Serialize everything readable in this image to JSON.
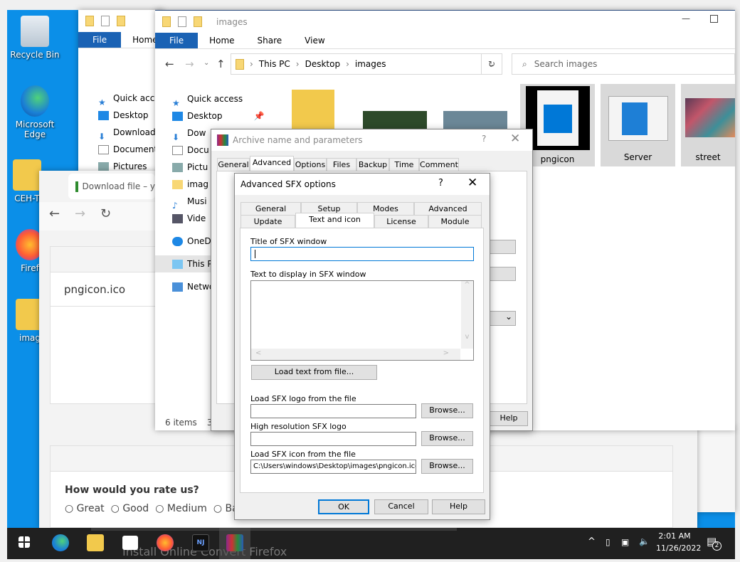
{
  "desktop": {
    "icons": [
      {
        "label": "Recycle Bin"
      },
      {
        "label": "Microsoft Edge"
      },
      {
        "label": "CEH-T"
      },
      {
        "label": "Firef"
      },
      {
        "label": "imag"
      }
    ]
  },
  "explorer_back": {
    "tabs": [
      "File",
      "Home"
    ],
    "nav": [
      "Quick acces",
      "Desktop",
      "Download",
      "Document",
      "Pictures"
    ]
  },
  "explorer": {
    "title": "images",
    "tabs": [
      "File",
      "Home",
      "Share",
      "View"
    ],
    "breadcrumb": [
      "This PC",
      "Desktop",
      "images"
    ],
    "search_placeholder": "Search images",
    "nav": [
      "Quick access",
      "Desktop",
      "Dow",
      "Docu",
      "Pictu",
      "imag",
      "Musi",
      "Vide",
      "OneDr",
      "This P",
      "Netwo"
    ],
    "items": [
      {
        "name": ""
      },
      {
        "name": ""
      },
      {
        "name": ""
      },
      {
        "name": "pngicon"
      },
      {
        "name": "Server"
      },
      {
        "name": "street"
      }
    ],
    "status": "6 items",
    "status2": "3"
  },
  "browser": {
    "tab_title": "Download file – y",
    "file_name": "pngicon.ico",
    "rate_question": "How would you rate us?",
    "rate_options": [
      "Great",
      "Good",
      "Medium",
      "Ba"
    ],
    "bottom_text": "Install Online Convert Firefox"
  },
  "archive_dialog": {
    "title": "Archive name and parameters",
    "help": "?",
    "tabs": [
      "General",
      "Advanced",
      "Options",
      "Files",
      "Backup",
      "Time",
      "Comment"
    ],
    "active_tab": "Advanced",
    "help_button": "Help"
  },
  "sfx_dialog": {
    "title": "Advanced SFX options",
    "help": "?",
    "tabs_row1": [
      "General",
      "Setup",
      "Modes",
      "Advanced"
    ],
    "tabs_row2": [
      "Update",
      "Text and icon",
      "License",
      "Module"
    ],
    "active_tab": "Text and icon",
    "title_label": "Title of SFX window",
    "title_value": "",
    "text_label": "Text to display in SFX window",
    "text_value": "",
    "load_text_button": "Load text from file...",
    "logo_label": "Load SFX logo from the file",
    "logo_value": "",
    "browse": "Browse...",
    "hires_label": "High resolution SFX logo",
    "hires_value": "",
    "icon_label": "Load SFX icon from the file",
    "icon_value": "C:\\Users\\windows\\Desktop\\images\\pngicon.ico",
    "ok": "OK",
    "cancel": "Cancel",
    "help_button": "Help"
  },
  "taskbar": {
    "apps": [
      "start-icon",
      "edge-icon",
      "file-explorer-icon",
      "mail-icon",
      "firefox-icon",
      "nj-icon",
      "winrar-icon"
    ],
    "time": "2:01 AM",
    "date": "11/26/2022",
    "notifications": "2"
  },
  "colors": {
    "desktop": "#0b8fe8",
    "accent": "#0078d7",
    "file_tab": "#1a62b4",
    "taskbar": "#202020"
  }
}
